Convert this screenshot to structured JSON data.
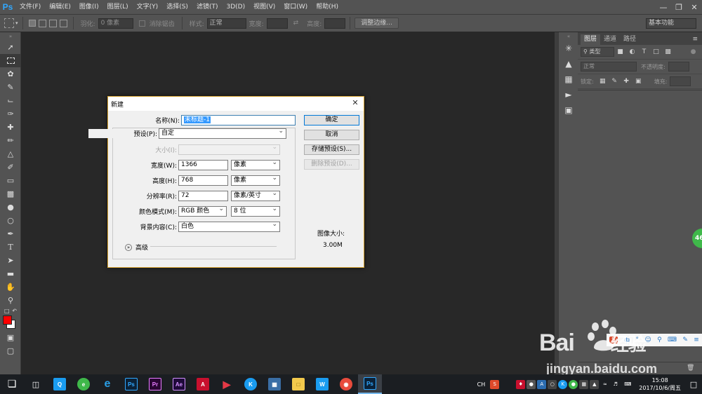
{
  "app": {
    "logo": "Ps"
  },
  "menu": [
    "文件(F)",
    "编辑(E)",
    "图像(I)",
    "图层(L)",
    "文字(Y)",
    "选择(S)",
    "滤镜(T)",
    "3D(D)",
    "视图(V)",
    "窗口(W)",
    "帮助(H)"
  ],
  "options": {
    "feather_label": "羽化:",
    "feather_value": "0 像素",
    "antialias_label": "消除锯齿",
    "style_label": "样式:",
    "style_value": "正常",
    "width_label": "宽度:",
    "height_label": "高度:",
    "refine_edge_button": "调整边缘...",
    "workspace": "基本功能"
  },
  "layers_panel": {
    "tabs": [
      "图层",
      "通道",
      "路径"
    ],
    "kind_filter": "类型",
    "blend_mode": "正常",
    "opacity_label": "不透明度:",
    "lock_label": "锁定:",
    "fill_label": "填充:"
  },
  "dialog": {
    "title": "新建",
    "name_label": "名称(N):",
    "name_value": "未标题-1",
    "preset_label": "预设(P):",
    "preset_value": "自定",
    "size_label": "大小(I):",
    "width_label": "宽度(W):",
    "width_value": "1366",
    "width_unit": "像素",
    "height_label": "高度(H):",
    "height_value": "768",
    "height_unit": "像素",
    "resolution_label": "分辨率(R):",
    "resolution_value": "72",
    "resolution_unit": "像素/英寸",
    "color_mode_label": "颜色模式(M):",
    "color_mode_value": "RGB 颜色",
    "bit_depth_value": "8 位",
    "background_label": "背景内容(C):",
    "background_value": "白色",
    "advanced_label": "高级",
    "ok_button": "确定",
    "cancel_button": "取消",
    "save_preset_button": "存储预设(S)...",
    "delete_preset_button": "删除预设(D)...",
    "image_size_label": "图像大小:",
    "image_size_value": "3.00M"
  },
  "badge": "46",
  "watermark": {
    "logo": "Bai",
    "logo2": "经验",
    "url": "jingyan.baidu.com",
    "ime": "中"
  },
  "taskbar": {
    "ime": "CH",
    "time": "15:08",
    "date": "2017/10/6/周五"
  },
  "colors": {
    "foreground": "#ff0000",
    "background": "#ffffff",
    "dialog_border": "#d8a432",
    "accent": "#0078d7"
  }
}
